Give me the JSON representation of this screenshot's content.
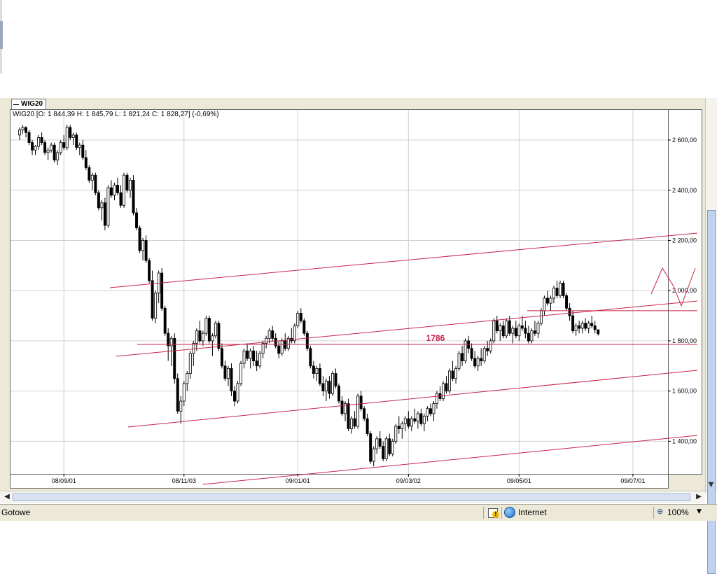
{
  "tab": {
    "label": "WIG20"
  },
  "header": {
    "ohlc_text": "WIG20 [O: 1 844,39   H: 1 845,79   L: 1 821,24   C: 1 828,27] (-0,69%)"
  },
  "status": {
    "left_text": "Gotowe",
    "zone": "Internet",
    "zoom": "100%"
  },
  "colors": {
    "trend_lines": "#c8244a",
    "annotation": "#c8244a",
    "candles": "#000000",
    "grid": "#d0d0d0",
    "plot_bg": "#ffffff",
    "frame_bg": "#ece9d8"
  },
  "chart_data": {
    "type": "candlestick",
    "title": "WIG20",
    "ylim": [
      1270,
      2720
    ],
    "yticks": [
      {
        "value": 2600,
        "label": "2 600,00"
      },
      {
        "value": 2400,
        "label": "2 400,00"
      },
      {
        "value": 2200,
        "label": "2 200,00"
      },
      {
        "value": 2000,
        "label": "2 000,00"
      },
      {
        "value": 1800,
        "label": "1 800,00"
      },
      {
        "value": 1600,
        "label": "1 600,00"
      },
      {
        "value": 1400,
        "label": "1 400,00"
      }
    ],
    "xticks": [
      {
        "label": "08/09/01",
        "index": 14
      },
      {
        "label": "08/11/03",
        "index": 52
      },
      {
        "label": "09/01/01",
        "index": 88
      },
      {
        "label": "09/03/02",
        "index": 123
      },
      {
        "label": "09/05/01",
        "index": 158
      },
      {
        "label": "09/07/01",
        "index": 194
      }
    ],
    "grid": true,
    "n_slots": 203,
    "candles": [
      [
        2620,
        2650,
        2600,
        2640
      ],
      [
        2640,
        2660,
        2625,
        2650
      ],
      [
        2650,
        2655,
        2610,
        2630
      ],
      [
        2630,
        2640,
        2580,
        2590
      ],
      [
        2590,
        2600,
        2540,
        2560
      ],
      [
        2560,
        2580,
        2540,
        2575
      ],
      [
        2575,
        2620,
        2560,
        2610
      ],
      [
        2610,
        2630,
        2580,
        2590
      ],
      [
        2590,
        2600,
        2540,
        2550
      ],
      [
        2550,
        2570,
        2520,
        2560
      ],
      [
        2560,
        2590,
        2550,
        2580
      ],
      [
        2580,
        2590,
        2510,
        2520
      ],
      [
        2520,
        2560,
        2500,
        2550
      ],
      [
        2550,
        2600,
        2540,
        2590
      ],
      [
        2590,
        2620,
        2560,
        2570
      ],
      [
        2570,
        2660,
        2560,
        2650
      ],
      [
        2650,
        2660,
        2600,
        2610
      ],
      [
        2610,
        2630,
        2580,
        2620
      ],
      [
        2620,
        2630,
        2560,
        2570
      ],
      [
        2570,
        2590,
        2540,
        2580
      ],
      [
        2580,
        2600,
        2520,
        2530
      ],
      [
        2530,
        2560,
        2480,
        2490
      ],
      [
        2490,
        2500,
        2430,
        2440
      ],
      [
        2440,
        2470,
        2400,
        2460
      ],
      [
        2460,
        2470,
        2380,
        2390
      ],
      [
        2390,
        2400,
        2320,
        2330
      ],
      [
        2330,
        2360,
        2280,
        2350
      ],
      [
        2350,
        2370,
        2240,
        2260
      ],
      [
        2260,
        2420,
        2250,
        2410
      ],
      [
        2410,
        2440,
        2370,
        2380
      ],
      [
        2380,
        2430,
        2360,
        2420
      ],
      [
        2420,
        2450,
        2380,
        2390
      ],
      [
        2390,
        2420,
        2330,
        2340
      ],
      [
        2340,
        2470,
        2330,
        2460
      ],
      [
        2460,
        2470,
        2390,
        2400
      ],
      [
        2400,
        2450,
        2370,
        2440
      ],
      [
        2440,
        2460,
        2300,
        2310
      ],
      [
        2310,
        2330,
        2240,
        2250
      ],
      [
        2250,
        2260,
        2150,
        2160
      ],
      [
        2160,
        2210,
        2120,
        2200
      ],
      [
        2200,
        2220,
        2110,
        2120
      ],
      [
        2120,
        2130,
        2030,
        2040
      ],
      [
        2040,
        2080,
        1880,
        1890
      ],
      [
        1890,
        2000,
        1870,
        1990
      ],
      [
        1990,
        2080,
        1950,
        2070
      ],
      [
        2070,
        2090,
        1920,
        1930
      ],
      [
        1930,
        1940,
        1820,
        1830
      ],
      [
        1830,
        1850,
        1720,
        1780
      ],
      [
        1780,
        1820,
        1700,
        1810
      ],
      [
        1810,
        1830,
        1630,
        1650
      ],
      [
        1650,
        1670,
        1510,
        1520
      ],
      [
        1520,
        1580,
        1470,
        1560
      ],
      [
        1560,
        1640,
        1540,
        1630
      ],
      [
        1630,
        1680,
        1600,
        1670
      ],
      [
        1670,
        1760,
        1650,
        1750
      ],
      [
        1750,
        1800,
        1700,
        1790
      ],
      [
        1790,
        1850,
        1760,
        1840
      ],
      [
        1840,
        1880,
        1790,
        1800
      ],
      [
        1800,
        1840,
        1780,
        1830
      ],
      [
        1830,
        1900,
        1820,
        1890
      ],
      [
        1890,
        1900,
        1790,
        1800
      ],
      [
        1800,
        1830,
        1740,
        1820
      ],
      [
        1820,
        1880,
        1810,
        1870
      ],
      [
        1870,
        1880,
        1760,
        1770
      ],
      [
        1770,
        1790,
        1690,
        1700
      ],
      [
        1700,
        1720,
        1640,
        1650
      ],
      [
        1650,
        1700,
        1620,
        1690
      ],
      [
        1690,
        1710,
        1580,
        1600
      ],
      [
        1600,
        1620,
        1540,
        1560
      ],
      [
        1560,
        1640,
        1550,
        1630
      ],
      [
        1630,
        1720,
        1620,
        1710
      ],
      [
        1710,
        1770,
        1690,
        1760
      ],
      [
        1760,
        1790,
        1720,
        1730
      ],
      [
        1730,
        1770,
        1690,
        1760
      ],
      [
        1760,
        1780,
        1700,
        1720
      ],
      [
        1720,
        1760,
        1680,
        1700
      ],
      [
        1700,
        1760,
        1690,
        1750
      ],
      [
        1750,
        1800,
        1730,
        1790
      ],
      [
        1790,
        1820,
        1770,
        1810
      ],
      [
        1810,
        1850,
        1790,
        1840
      ],
      [
        1840,
        1860,
        1800,
        1810
      ],
      [
        1810,
        1830,
        1770,
        1780
      ],
      [
        1780,
        1800,
        1730,
        1750
      ],
      [
        1750,
        1810,
        1740,
        1800
      ],
      [
        1800,
        1830,
        1760,
        1770
      ],
      [
        1770,
        1820,
        1760,
        1810
      ],
      [
        1810,
        1850,
        1790,
        1800
      ],
      [
        1800,
        1870,
        1790,
        1860
      ],
      [
        1860,
        1920,
        1850,
        1910
      ],
      [
        1910,
        1930,
        1870,
        1880
      ],
      [
        1880,
        1890,
        1820,
        1830
      ],
      [
        1830,
        1840,
        1760,
        1770
      ],
      [
        1770,
        1780,
        1690,
        1700
      ],
      [
        1700,
        1720,
        1650,
        1670
      ],
      [
        1670,
        1700,
        1640,
        1690
      ],
      [
        1690,
        1710,
        1620,
        1630
      ],
      [
        1630,
        1660,
        1580,
        1600
      ],
      [
        1600,
        1650,
        1560,
        1640
      ],
      [
        1640,
        1660,
        1570,
        1590
      ],
      [
        1590,
        1680,
        1580,
        1670
      ],
      [
        1670,
        1690,
        1610,
        1620
      ],
      [
        1620,
        1630,
        1550,
        1560
      ],
      [
        1560,
        1580,
        1500,
        1510
      ],
      [
        1510,
        1560,
        1480,
        1550
      ],
      [
        1550,
        1570,
        1440,
        1450
      ],
      [
        1450,
        1500,
        1430,
        1490
      ],
      [
        1490,
        1520,
        1450,
        1460
      ],
      [
        1460,
        1590,
        1450,
        1580
      ],
      [
        1580,
        1600,
        1520,
        1530
      ],
      [
        1530,
        1540,
        1480,
        1490
      ],
      [
        1490,
        1510,
        1420,
        1430
      ],
      [
        1430,
        1440,
        1310,
        1320
      ],
      [
        1320,
        1380,
        1300,
        1370
      ],
      [
        1370,
        1420,
        1350,
        1410
      ],
      [
        1410,
        1440,
        1370,
        1380
      ],
      [
        1380,
        1400,
        1320,
        1330
      ],
      [
        1330,
        1420,
        1320,
        1410
      ],
      [
        1410,
        1430,
        1340,
        1350
      ],
      [
        1350,
        1410,
        1340,
        1400
      ],
      [
        1400,
        1470,
        1390,
        1460
      ],
      [
        1460,
        1500,
        1430,
        1450
      ],
      [
        1450,
        1480,
        1410,
        1470
      ],
      [
        1470,
        1500,
        1440,
        1490
      ],
      [
        1490,
        1520,
        1450,
        1460
      ],
      [
        1460,
        1500,
        1440,
        1490
      ],
      [
        1490,
        1530,
        1470,
        1480
      ],
      [
        1480,
        1520,
        1450,
        1510
      ],
      [
        1510,
        1530,
        1460,
        1470
      ],
      [
        1470,
        1510,
        1440,
        1500
      ],
      [
        1500,
        1540,
        1480,
        1530
      ],
      [
        1530,
        1550,
        1500,
        1510
      ],
      [
        1510,
        1560,
        1480,
        1550
      ],
      [
        1550,
        1600,
        1530,
        1590
      ],
      [
        1590,
        1620,
        1560,
        1570
      ],
      [
        1570,
        1640,
        1560,
        1630
      ],
      [
        1630,
        1660,
        1590,
        1600
      ],
      [
        1600,
        1690,
        1590,
        1680
      ],
      [
        1680,
        1720,
        1640,
        1650
      ],
      [
        1650,
        1700,
        1630,
        1690
      ],
      [
        1690,
        1760,
        1680,
        1750
      ],
      [
        1750,
        1780,
        1700,
        1720
      ],
      [
        1720,
        1810,
        1710,
        1800
      ],
      [
        1800,
        1820,
        1750,
        1770
      ],
      [
        1770,
        1790,
        1720,
        1730
      ],
      [
        1730,
        1760,
        1690,
        1700
      ],
      [
        1700,
        1740,
        1680,
        1730
      ],
      [
        1730,
        1770,
        1700,
        1720
      ],
      [
        1720,
        1780,
        1710,
        1770
      ],
      [
        1770,
        1800,
        1740,
        1760
      ],
      [
        1760,
        1810,
        1750,
        1800
      ],
      [
        1800,
        1890,
        1790,
        1880
      ],
      [
        1880,
        1900,
        1830,
        1840
      ],
      [
        1840,
        1870,
        1800,
        1860
      ],
      [
        1860,
        1880,
        1810,
        1820
      ],
      [
        1820,
        1890,
        1810,
        1880
      ],
      [
        1880,
        1900,
        1820,
        1830
      ],
      [
        1830,
        1860,
        1790,
        1850
      ],
      [
        1850,
        1880,
        1810,
        1820
      ],
      [
        1820,
        1870,
        1800,
        1860
      ],
      [
        1860,
        1900,
        1840,
        1850
      ],
      [
        1850,
        1880,
        1810,
        1830
      ],
      [
        1830,
        1860,
        1790,
        1800
      ],
      [
        1800,
        1850,
        1790,
        1840
      ],
      [
        1840,
        1880,
        1820,
        1830
      ],
      [
        1830,
        1880,
        1810,
        1870
      ],
      [
        1870,
        1930,
        1860,
        1920
      ],
      [
        1920,
        1980,
        1900,
        1970
      ],
      [
        1970,
        2000,
        1940,
        1950
      ],
      [
        1950,
        1980,
        1920,
        1970
      ],
      [
        1970,
        2020,
        1950,
        2010
      ],
      [
        2010,
        2040,
        1970,
        1980
      ],
      [
        1980,
        2040,
        1970,
        2030
      ],
      [
        2030,
        2040,
        1970,
        1980
      ],
      [
        1980,
        1990,
        1920,
        1930
      ],
      [
        1930,
        1950,
        1880,
        1900
      ],
      [
        1900,
        1920,
        1830,
        1840
      ],
      [
        1840,
        1870,
        1820,
        1860
      ],
      [
        1860,
        1880,
        1830,
        1850
      ],
      [
        1850,
        1880,
        1830,
        1870
      ],
      [
        1870,
        1890,
        1840,
        1850
      ],
      [
        1850,
        1880,
        1830,
        1870
      ],
      [
        1870,
        1900,
        1850,
        1860
      ],
      [
        1860,
        1880,
        1830,
        1845
      ],
      [
        1844,
        1846,
        1821,
        1828
      ]
    ],
    "channel_lines": [
      {
        "x1": 157,
        "y1": 411,
        "x2": 996,
        "y2": 333
      },
      {
        "x1": 166,
        "y1": 509,
        "x2": 996,
        "y2": 430
      },
      {
        "x1": 183,
        "y1": 610,
        "x2": 996,
        "y2": 529
      },
      {
        "x1": 290,
        "y1": 692,
        "x2": 996,
        "y2": 622
      }
    ],
    "horizontal_levels": [
      {
        "value": 1786,
        "label": "1786",
        "x_from": 196,
        "x_to": 996
      },
      {
        "value": 1920,
        "label": "",
        "x_from": 753,
        "x_to": 996
      }
    ],
    "projection_path": [
      [
        930,
        420
      ],
      [
        946,
        383
      ],
      [
        962,
        409
      ],
      [
        973,
        437
      ],
      [
        993,
        383
      ]
    ]
  }
}
